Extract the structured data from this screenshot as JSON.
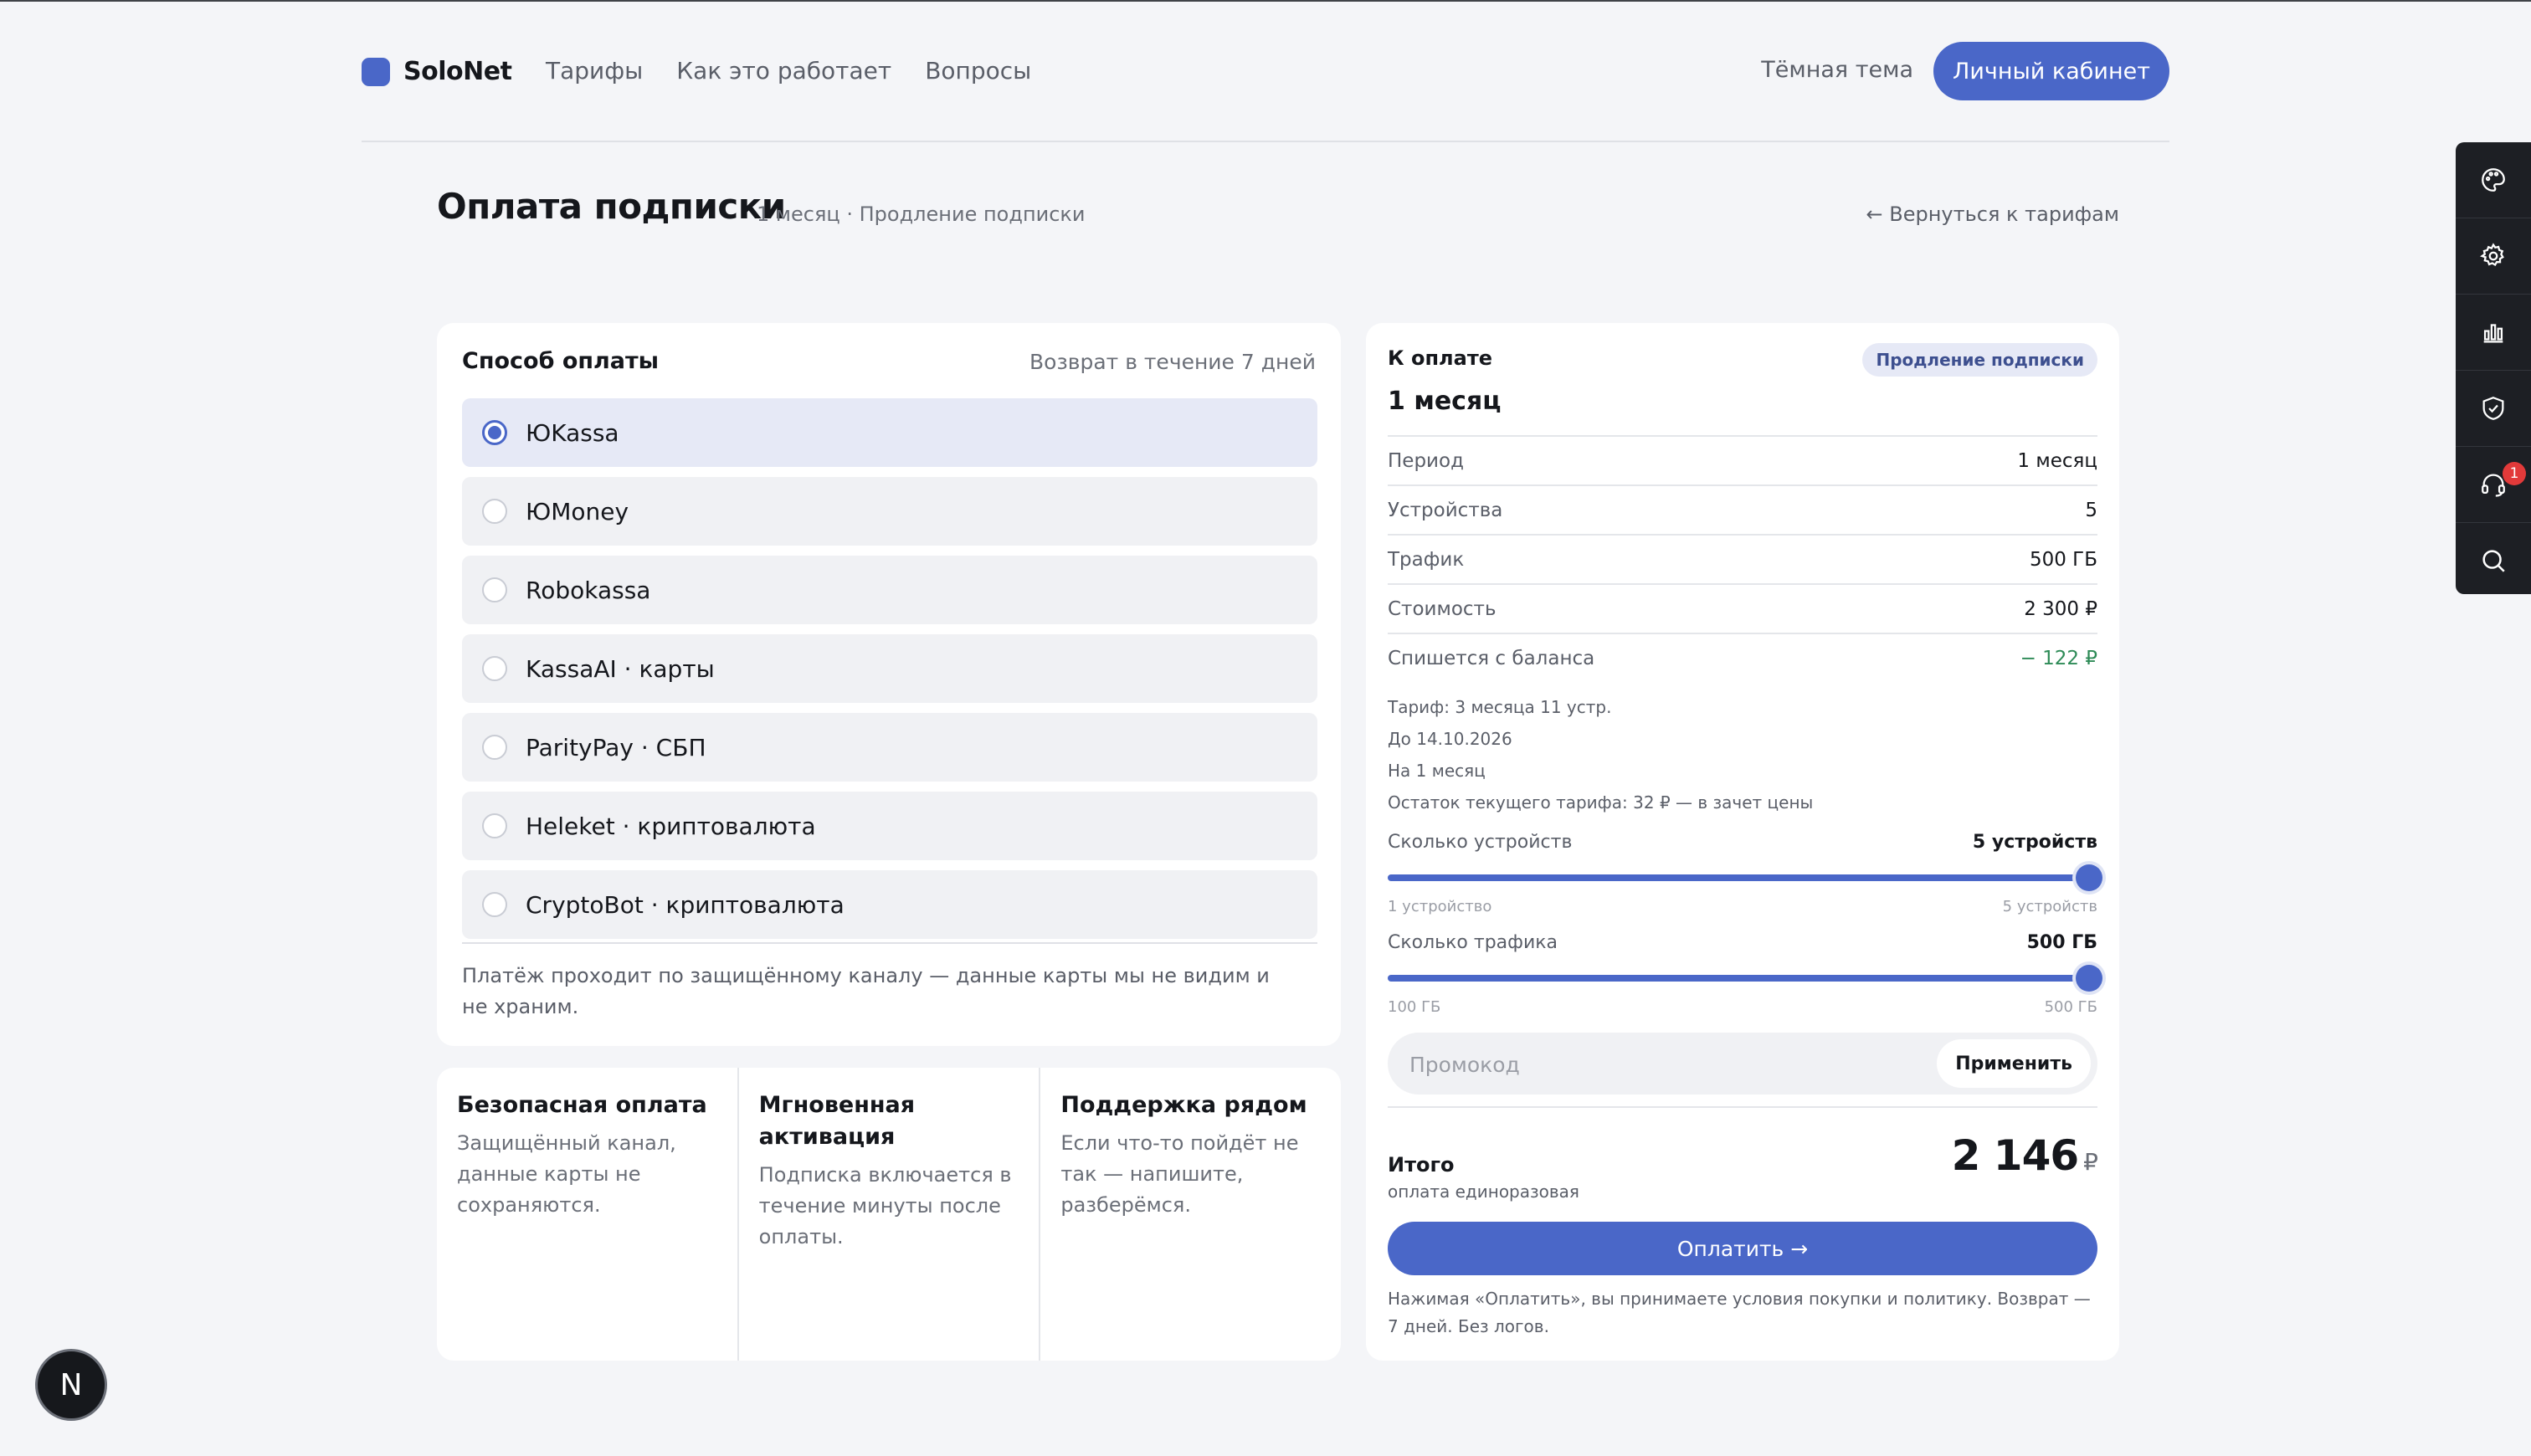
{
  "header": {
    "logo_text": "SoloNet",
    "nav": [
      "Тарифы",
      "Как это работает",
      "Вопросы"
    ],
    "theme_toggle": "Тёмная тема",
    "cabinet_button": "Личный кабинет"
  },
  "page": {
    "title": "Оплата подписки",
    "subtitle": "1 месяц · Продление подписки",
    "back_link": "← Вернуться к тарифам"
  },
  "payment": {
    "title": "Способ оплаты",
    "refund_note": "Возврат в течение 7 дней",
    "selected": "ЮKassa",
    "methods": [
      "ЮKassa",
      "ЮMoney",
      "Robokassa",
      "KassaAI · карты",
      "ParityPay · СБП",
      "Heleket · криптовалюта",
      "CryptoBot · криптовалюта"
    ],
    "security_note": "Платёж проходит по защищённому каналу — данные карты мы не видим и не храним."
  },
  "features": [
    {
      "title": "Безопасная оплата",
      "text": "Защищённый канал, данные карты не сохраняются."
    },
    {
      "title": "Мгновенная активация",
      "text": "Подписка включается в течение минуты после оплаты."
    },
    {
      "title": "Поддержка рядом",
      "text": "Если что-то пойдёт не так — напишите, разберёмся."
    }
  ],
  "summary": {
    "label": "К оплате",
    "badge": "Продление подписки",
    "plan": "1 месяц",
    "rows": [
      {
        "key": "Период",
        "value": "1 месяц"
      },
      {
        "key": "Устройства",
        "value": "5"
      },
      {
        "key": "Трафик",
        "value": "500 ГБ"
      },
      {
        "key": "Стоимость",
        "value": "2 300 ₽"
      },
      {
        "key": "Спишется с баланса",
        "value": "− 122 ₽"
      }
    ],
    "details": [
      "Тариф: 3 месяца 11 устр.",
      "До 14.10.2026",
      "На 1 месяц",
      "Остаток текущего тарифа: 32 ₽ — в зачет цены"
    ],
    "devices_slider": {
      "label": "Сколько устройств",
      "value_text": "5 устройств",
      "min_label": "1 устройство",
      "max_label": "5 устройств",
      "min": 1,
      "max": 5,
      "value": 5
    },
    "traffic_slider": {
      "label": "Сколько трафика",
      "value_text": "500 ГБ",
      "min_label": "100 ГБ",
      "max_label": "500 ГБ",
      "min": 100,
      "max": 500,
      "value": 500
    },
    "promo_placeholder": "Промокод",
    "promo_button": "Применить",
    "total_label": "Итого",
    "total_sub": "оплата единоразовая",
    "total_amount": "2 146",
    "currency": "₽",
    "pay_button": "Оплатить →",
    "terms": "Нажимая «Оплатить», вы принимаете условия покупки и политику. Возврат — 7 дней. Без логов."
  },
  "toolbar": {
    "icons": [
      "palette-icon",
      "settings-icon",
      "chart-icon",
      "shield-icon",
      "headset-icon",
      "search-icon"
    ],
    "support_badge": "1"
  },
  "next_badge": "N",
  "colors": {
    "accent": "#4a67c8",
    "background": "#f4f5f8",
    "balance_green": "#2e8b57",
    "badge_red": "#e23a3a"
  }
}
